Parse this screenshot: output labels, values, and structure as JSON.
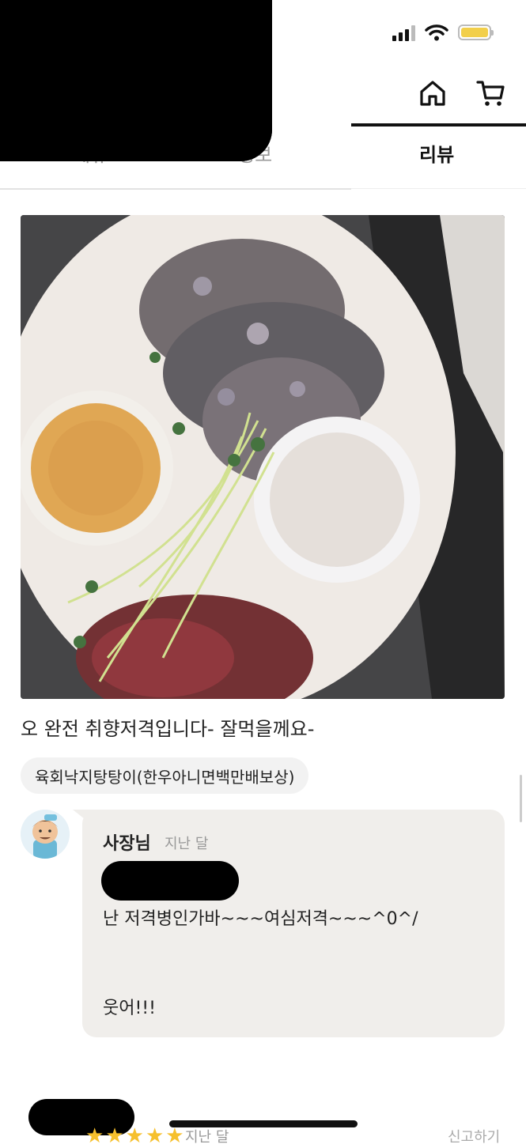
{
  "status_bar": {
    "signal_icon": "cellular-signal-icon",
    "wifi_icon": "wifi-icon",
    "battery_icon": "battery-icon"
  },
  "header": {
    "home_icon": "home-icon",
    "cart_icon": "cart-icon"
  },
  "tabs": [
    {
      "label": "메뉴"
    },
    {
      "label": "정보"
    },
    {
      "label": "리뷰"
    }
  ],
  "review": {
    "photo_description_icon": "food-photo",
    "text": "오 완전 취향저격입니다- 잘먹을께요-",
    "menu_chip": "육회낙지탕탕이(한우아니면백만배보상)"
  },
  "owner_reply": {
    "name": "사장님",
    "date": "지난 달",
    "line1": "난 저격병인가바~~~여심저격~~~^0^/",
    "line2": "웃어!!!"
  },
  "next_review": {
    "stars": [
      "★",
      "★",
      "★",
      "★",
      "★"
    ],
    "date": "지난 달",
    "report_label": "신고하기"
  },
  "colors": {
    "accent_dark": "#111111",
    "star": "#f6c02d",
    "bubble": "#f0eeeb",
    "battery": "#f2cf4a"
  }
}
